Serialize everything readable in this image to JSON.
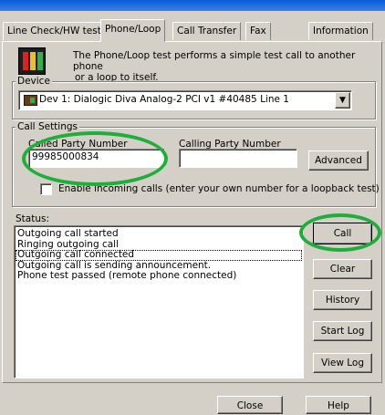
{
  "tabs": [
    {
      "label": "Line Check/HW test"
    },
    {
      "label": "Phone/Loop"
    },
    {
      "label": "Call Transfer"
    },
    {
      "label": "Fax"
    },
    {
      "label": "Information"
    }
  ],
  "intro": {
    "line1": "The Phone/Loop test performs a simple test call to another phone",
    "line2": "or a loop to itself."
  },
  "device": {
    "group_label": "Device",
    "selected": "Dev 1: Dialogic Diva Analog-2 PCI v1 #40485 Line 1"
  },
  "call_settings": {
    "group_label": "Call Settings",
    "called_label": "Called Party Number",
    "called_value": "99985000834",
    "calling_label": "Calling Party Number",
    "calling_value": "",
    "advanced_button": "Advanced",
    "enable_incoming_label": "Enable incoming calls (enter your own number for a loopback test)"
  },
  "status": {
    "label": "Status:",
    "lines": [
      "Outgoing call started",
      "Ringing outgoing call",
      "Outgoing call connected",
      "Outgoing call is sending announcement.",
      "Phone test passed (remote phone connected)"
    ]
  },
  "buttons": {
    "call": "Call",
    "clear": "Clear",
    "history": "History",
    "start_log": "Start Log",
    "view_log": "View Log"
  },
  "footer": {
    "close": "Close",
    "help": "Help"
  },
  "colors": {
    "dialog_bg": "#d4d0c8",
    "highlight_oval": "#1fae3a"
  }
}
